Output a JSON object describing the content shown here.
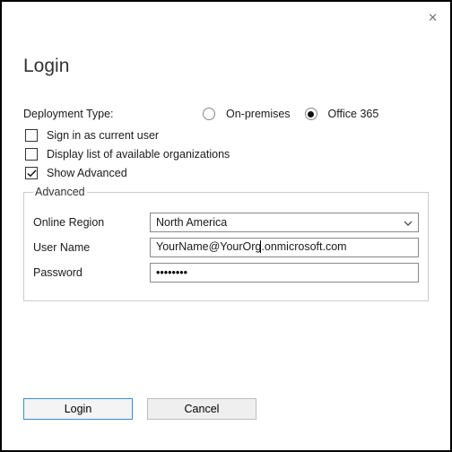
{
  "close_icon": "✕",
  "title": "Login",
  "deployment": {
    "label": "Deployment Type:",
    "options": {
      "on_premises": "On-premises",
      "office_365": "Office 365"
    },
    "selected": "office_365"
  },
  "checkboxes": {
    "sign_in_current": {
      "label": "Sign in as current user",
      "checked": false
    },
    "display_orgs": {
      "label": "Display list of available organizations",
      "checked": false
    },
    "show_advanced": {
      "label": "Show Advanced",
      "checked": true
    }
  },
  "advanced": {
    "legend": "Advanced",
    "online_region": {
      "label": "Online Region",
      "value": "North America"
    },
    "user_name": {
      "label": "User Name",
      "value_before_caret": "YourName@YourOrg",
      "value_after_caret": ".onmicrosoft.com"
    },
    "password": {
      "label": "Password",
      "masked": "••••••••"
    }
  },
  "buttons": {
    "login": "Login",
    "cancel": "Cancel"
  }
}
